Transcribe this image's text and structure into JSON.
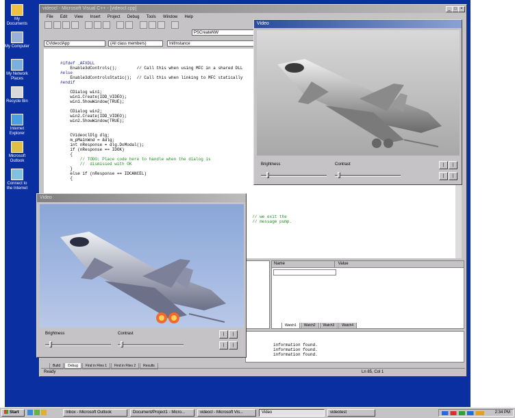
{
  "desktop_icons": [
    {
      "label": "My Documents",
      "icon": "folder-icon",
      "color": "#f0c040"
    },
    {
      "label": "My Computer",
      "icon": "computer-icon",
      "color": "#9ab0d8"
    },
    {
      "label": "My Network Places",
      "icon": "network-icon",
      "color": "#78b0e0"
    },
    {
      "label": "Recycle Bin",
      "icon": "recycle-bin-icon",
      "color": "#d8d8d8"
    },
    {
      "label": "Internet Explorer",
      "icon": "globe-icon",
      "color": "#4aa0e0"
    },
    {
      "label": "Microsoft Outlook",
      "icon": "outlook-icon",
      "color": "#e0c040"
    },
    {
      "label": "Connect to the Internet",
      "icon": "connect-icon",
      "color": "#80c0e0"
    }
  ],
  "ide": {
    "title": "videocl - Microsoft Visual C++ - [videocl.cpp]",
    "menu": [
      "File",
      "Edit",
      "View",
      "Insert",
      "Project",
      "Debug",
      "Tools",
      "Window",
      "Help"
    ],
    "class_combo": "CVideoclApp",
    "members_combo": "(All class members)",
    "function_combo": "InitInstance",
    "find_combo": "PSCreateNW",
    "code_lines": [
      {
        "t": "#ifdef _AFXDLL",
        "k": "k"
      },
      {
        "t": "    Enable3dControls();        // Call this when using MFC in a shared DLL",
        "k": ""
      },
      {
        "t": "#else",
        "k": "k"
      },
      {
        "t": "    Enable3dControlsStatic();  // Call this when linking to MFC statically",
        "k": ""
      },
      {
        "t": "#endif",
        "k": "k"
      },
      {
        "t": "",
        "k": ""
      },
      {
        "t": "    CDialog win1;",
        "k": ""
      },
      {
        "t": "    win1.Create(IDD_VIDEO);",
        "k": ""
      },
      {
        "t": "    win1.ShowWindow(TRUE);",
        "k": ""
      },
      {
        "t": "",
        "k": ""
      },
      {
        "t": "    CDialog win2;",
        "k": ""
      },
      {
        "t": "    win2.Create(IDD_VIDEO);",
        "k": ""
      },
      {
        "t": "    win2.ShowWindow(TRUE);",
        "k": ""
      },
      {
        "t": "",
        "k": ""
      },
      {
        "t": "",
        "k": ""
      },
      {
        "t": "    CVideoclDlg dlg;",
        "k": ""
      },
      {
        "t": "    m_pMainWnd = &dlg;",
        "k": ""
      },
      {
        "t": "    int nResponse = dlg.DoModal();",
        "k": ""
      },
      {
        "t": "    if (nResponse == IDOK)",
        "k": ""
      },
      {
        "t": "    {",
        "k": ""
      },
      {
        "t": "        // TODO: Place code here to handle when the dialog is",
        "k": "c"
      },
      {
        "t": "        //  dismissed with OK",
        "k": "c"
      },
      {
        "t": "    }",
        "k": ""
      },
      {
        "t": "    else if (nResponse == IDCANCEL)",
        "k": ""
      },
      {
        "t": "    {",
        "k": ""
      }
    ],
    "code_tail": [
      {
        "t": "    // we exit the",
        "k": "c"
      },
      {
        "t": "    // message pump.",
        "k": "c"
      }
    ],
    "watch_headers": [
      "Name",
      "Value"
    ],
    "watch_tabs": [
      "Watch1",
      "Watch2",
      "Watch3",
      "Watch4"
    ],
    "output_lines": [
      "information found.",
      "information found.",
      "information found."
    ],
    "bottom_tabs": [
      "Build",
      "Debug",
      "Find in Files 1",
      "Find in Files 2",
      "Results"
    ],
    "status_left": "Ready",
    "status_pos": "Ln 85, Col 1"
  },
  "video_window_top": {
    "title": "Video",
    "brightness_label": "Brightness",
    "contrast_label": "Contrast"
  },
  "video_window_bottom": {
    "title": "Video",
    "brightness_label": "Brightness",
    "contrast_label": "Contrast"
  },
  "taskbar": {
    "start_label": "Start",
    "buttons": [
      "Inbox - Microsoft Outlook",
      "Document/Project1 - Micro...",
      "videocl - Microsoft Vis...",
      "Video",
      "videotest"
    ],
    "active_index": 3,
    "clock": "2:34 PM"
  }
}
